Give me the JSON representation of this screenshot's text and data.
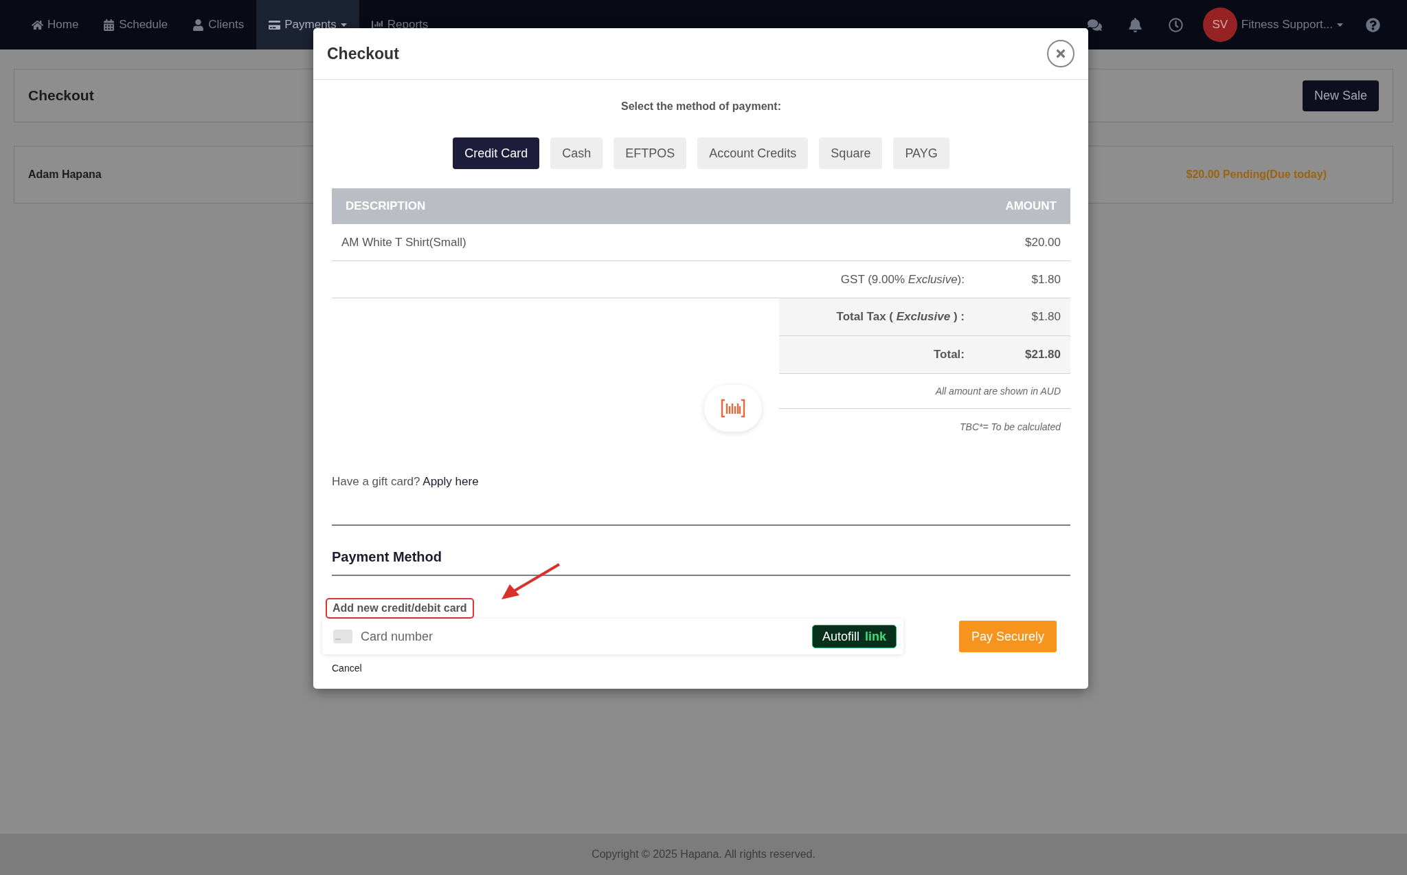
{
  "nav": {
    "items": [
      {
        "label": "Home",
        "selected": false
      },
      {
        "label": "Schedule",
        "selected": false
      },
      {
        "label": "Clients",
        "selected": false
      },
      {
        "label": "Payments",
        "selected": true,
        "dropdown": true
      },
      {
        "label": "Reports",
        "selected": false
      }
    ],
    "user": {
      "initials": "SV",
      "name": "Fitness Support..."
    }
  },
  "page": {
    "title": "Checkout",
    "new_sale": "New Sale",
    "customer": "Adam Hapana",
    "status": "$20.00 Pending(Due today)"
  },
  "modal": {
    "title": "Checkout",
    "prompt": "Select the method of payment:",
    "methods": [
      {
        "label": "Credit Card",
        "selected": true
      },
      {
        "label": "Cash",
        "selected": false
      },
      {
        "label": "EFTPOS",
        "selected": false
      },
      {
        "label": "Account Credits",
        "selected": false
      },
      {
        "label": "Square",
        "selected": false
      },
      {
        "label": "PAYG",
        "selected": false
      }
    ],
    "columns": [
      "DESCRIPTION",
      "AMOUNT"
    ],
    "items": [
      {
        "description": "AM White T Shirt(Small)",
        "amount": "$20.00"
      }
    ],
    "tax": {
      "label": "GST (9.00% *Exclusive*):",
      "amount": "$1.80"
    },
    "totals": [
      {
        "label": "Total Tax ( *Exclusive* ) :",
        "amount": "$1.80"
      },
      {
        "label": "Total:",
        "amount": "$21.80"
      }
    ],
    "currency_note": "All amount are shown in AUD",
    "tbc_note": "TBC*= To be calculated",
    "gift_card": {
      "text": "Have a gift card?",
      "link": "Apply here"
    },
    "section": "Payment Method",
    "add_card": "Add new credit/debit card",
    "card_field": {
      "placeholder": "Card number",
      "autofill": "Autofill",
      "autofill_brand": "link"
    },
    "pay": "Pay Securely",
    "cancel": "Cancel"
  },
  "footer": "Copyright © 2025 Hapana. All rights reserved."
}
